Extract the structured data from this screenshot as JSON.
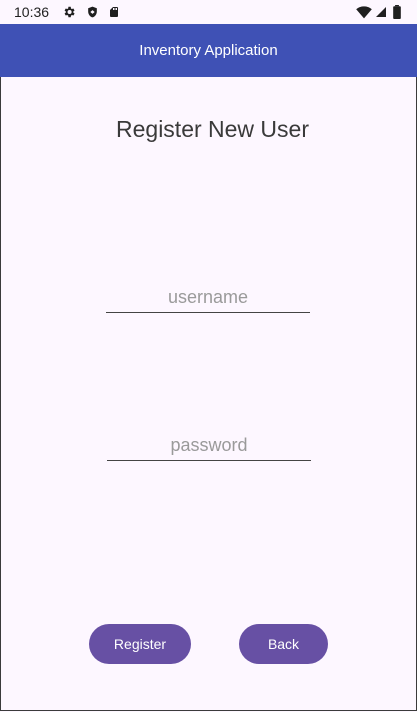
{
  "status_bar": {
    "time": "10:36",
    "left_icons": [
      "gear-icon",
      "shield-icon",
      "sd-card-icon"
    ],
    "right_icons": [
      "wifi-icon",
      "signal-icon",
      "battery-icon"
    ]
  },
  "app_bar": {
    "title": "Inventory Application",
    "color": "#3f51b5"
  },
  "page": {
    "title": "Register New User",
    "background": "#fdf7ff"
  },
  "form": {
    "username": {
      "value": "",
      "placeholder": "username"
    },
    "password": {
      "value": "",
      "placeholder": "password"
    }
  },
  "buttons": {
    "register_label": "Register",
    "back_label": "Back",
    "color": "#6750a4"
  }
}
